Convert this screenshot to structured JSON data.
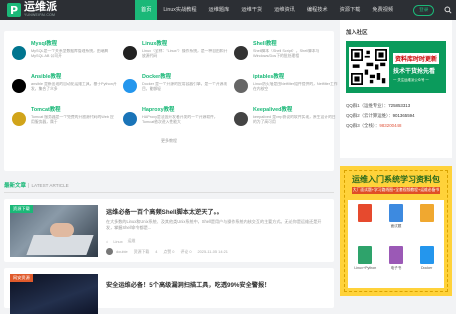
{
  "nav": {
    "logo_name": "运维派",
    "logo_domain": "YUNWEIPAI.COM",
    "items": [
      "首页",
      "Linux实战教程",
      "运维题库",
      "运维干货",
      "运维资讯",
      "编程技术",
      "资源下载",
      "免费视频"
    ],
    "login": "登录"
  },
  "courses": [
    {
      "title": "Mysql教程",
      "desc": "MySQL是一个关系型数据库管理系统，由瑞典MySQL AB 公司开",
      "icon": "mysql-dolphin-icon",
      "color": "#00758f"
    },
    {
      "title": "Linux教程",
      "desc": "Linux（全称：\"Linux\"）操作系统，是一种自由和开放源代码",
      "icon": "linux-tux-icon",
      "color": "#222222"
    },
    {
      "title": "Shell教程",
      "desc": "Shell脚本（Shell Script），Shell脚本与Windows/Dos下的批处理相",
      "icon": "shell-terminal-icon",
      "color": "#333333"
    },
    {
      "title": "Ansible教程",
      "desc": "ansible 是新出现的自动化运维工具，基于Python开发，集合了众多",
      "icon": "ansible-icon",
      "color": "#000000"
    },
    {
      "title": "Docker教程",
      "desc": "Docker 是一个开源的应用容器引擎，是一个开源项目，能够轻",
      "icon": "docker-whale-icon",
      "color": "#2496ed"
    },
    {
      "title": "iptables教程",
      "desc": "Linux防火墙是由Netfilter组件提供的，Netfilter工作在内核空",
      "icon": "iptables-icon",
      "color": "#666666"
    },
    {
      "title": "Tomcat教程",
      "desc": "Tomcat 服务器是一个免费的开放源代码的Web 应用服务器，属于",
      "icon": "tomcat-cat-icon",
      "color": "#d1a41a"
    },
    {
      "title": "Haproxy教程",
      "desc": "HAProxy是法国开发者开发的一个开源软件，Tomcat依次进入性能大",
      "icon": "haproxy-icon",
      "color": "#1a74b8"
    },
    {
      "title": "Keepalived教程",
      "desc": "keepalived 是vrrp协议的软件实现，原生设计的目的为了高可用",
      "icon": "keepalived-icon",
      "color": "#444444"
    }
  ],
  "more_label": "更多教程",
  "latest": {
    "title": "最新文章",
    "sep": "|",
    "en": "LATEST ARTICLE"
  },
  "article1": {
    "tag": "资源下载",
    "title": "运维必备一百个高频Shell脚本太逆天了。。",
    "desc": "在大多数的Linux和Unix系统、及其他类Unix系统中，Shell是用户与操作系统内核交互的主要方式。无论你是运维还是开发，掌握Shell命令都是...",
    "tags": [
      "Linux",
      "运维"
    ],
    "author": "doubie",
    "category": "资源下载",
    "views": "4",
    "likes": "点赞 0",
    "comments": "评论 0",
    "date": "2025-11-05 14:21"
  },
  "article2": {
    "tag": "网安资源",
    "title": "安全运维必备！5个高级漏洞扫描工具，吃透99%安全警报！"
  },
  "sidebar": {
    "join_title": "加入社区",
    "qr_line1": "资料库时时更新",
    "qr_line2": "技术干货抢先看",
    "qr_line3": "一 关注运维派公众号 一",
    "qq_rows": [
      {
        "label": "QQ群1（运维专业）：",
        "num": "725853313",
        "red": false
      },
      {
        "label": "QQ群2（云计算运维）：",
        "num": "901365594",
        "red": false
      },
      {
        "label": "QQ群3（全栈）：",
        "num": "983200448",
        "red": true
      }
    ],
    "promo_title": "运维入门系统学习资料包",
    "promo_sub": "大厂面试题+学习路线图+全套视频教程+运维必备书",
    "books": [
      {
        "label": "",
        "color": "#e64a2e"
      },
      {
        "label": "面试题",
        "color": "#3d8ae0"
      },
      {
        "label": "",
        "color": "#f0a830"
      },
      {
        "label": "Linux+Python",
        "color": "#2ea36b"
      },
      {
        "label": "电子书",
        "color": "#9b59b6"
      },
      {
        "label": "Docker",
        "color": "#2496ed"
      }
    ]
  }
}
